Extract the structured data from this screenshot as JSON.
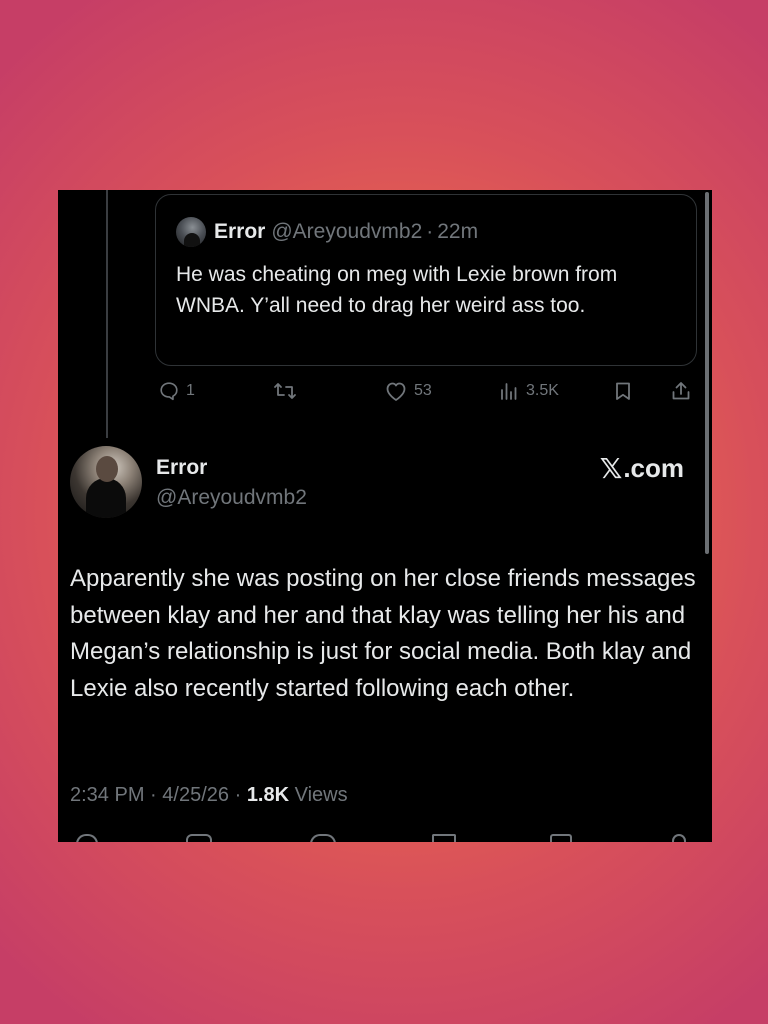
{
  "quoted_tweet": {
    "author_name": "Error",
    "handle": "@Areyoudvmb2",
    "separator": "·",
    "time": "22m",
    "text": "He was cheating on meg with Lexie brown from WNBA. Y’all need to drag her weird ass too."
  },
  "actions": {
    "replies": "1",
    "reposts": "",
    "likes": "53",
    "views": "3.5K",
    "icons": [
      "reply-icon",
      "repost-icon",
      "like-icon",
      "views-icon",
      "bookmark-icon",
      "share-icon"
    ]
  },
  "tweet": {
    "author_name": "Error",
    "handle": "@Areyoudvmb2",
    "brand": ".com",
    "text": "Apparently she was posting on her close friends messages between klay and her and that klay was telling her his and Megan’s relationship is just for social media. Both klay and Lexie also recently started following each other.",
    "time": "2:34 PM",
    "separator": "·",
    "date": "4/25/26",
    "views_count": "1.8K",
    "views_label": "Views"
  },
  "colors": {
    "background_gradient": [
      "#f07a52",
      "#c63e66"
    ],
    "card": "#000000",
    "text_primary": "#e7e9ea",
    "text_secondary": "#71767b",
    "border": "#2f3336"
  }
}
